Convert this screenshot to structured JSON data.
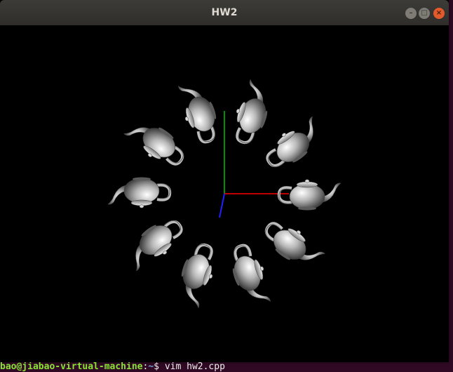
{
  "window": {
    "title": "HW2",
    "buttons": {
      "minimize": "–",
      "maximize": "□",
      "close": "×"
    },
    "colors": {
      "titlebar": "#3c3b37",
      "close": "#e25a2c",
      "canvas_bg": "#000000"
    }
  },
  "scene": {
    "axes": [
      {
        "name": "x-axis",
        "color": "#ff0000"
      },
      {
        "name": "y-axis",
        "color": "#00c000"
      },
      {
        "name": "z-axis",
        "color": "#2020ff"
      }
    ],
    "teapot_count": 10,
    "teapot_color": "#c8c8c8"
  },
  "terminal": {
    "user_host": "bao@jiabao-virtual-machine",
    "separator": ":",
    "path": "~",
    "prompt": "$ ",
    "command": "vim hw2.cpp"
  }
}
